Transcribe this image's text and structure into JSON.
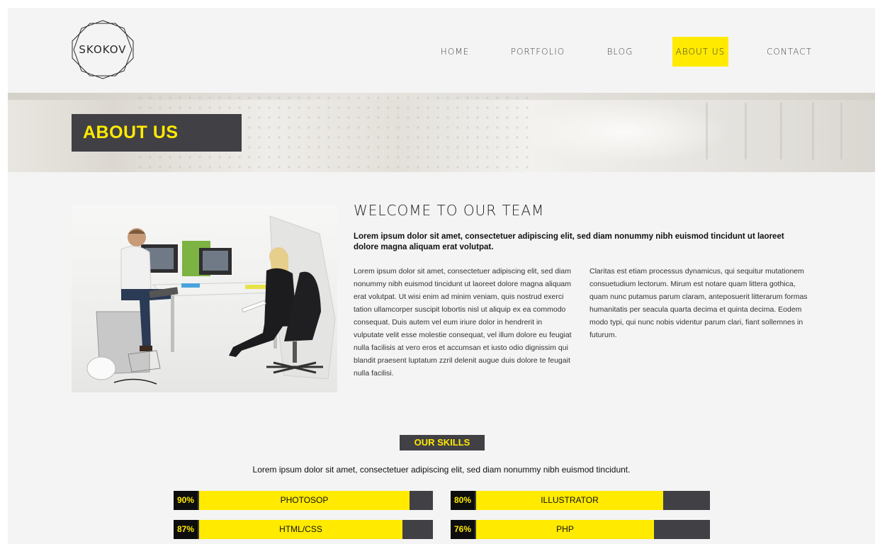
{
  "brand": {
    "logo_text": "SKOKOV",
    "accent": "#ffea00",
    "dark": "#414045"
  },
  "nav": {
    "items": [
      {
        "label": "HOME"
      },
      {
        "label": "PORTFOLIO"
      },
      {
        "label": "BLOG"
      },
      {
        "label": "ABOUT US"
      },
      {
        "label": "CONTACT"
      }
    ],
    "active": "ABOUT US"
  },
  "banner": {
    "title": "ABOUT US"
  },
  "welcome": {
    "title": "WELCOME TO OUR TEAM",
    "lead": "Lorem ipsum dolor sit amet, consectetuer adipiscing elit, sed diam nonummy nibh euismod tincidunt ut laoreet dolore magna aliquam erat volutpat.",
    "col1": "Lorem ipsum dolor sit amet, consectetuer adipiscing elit, sed diam nonummy nibh euismod tincidunt ut laoreet dolore magna aliquam erat volutpat. Ut wisi enim ad minim veniam, quis nostrud exerci tation ullamcorper suscipit lobortis nisl ut aliquip ex ea commodo consequat. Duis autem vel eum iriure dolor in hendrerit in vulputate velit esse molestie consequat, vel illum dolore eu feugiat nulla facilisis at vero eros et accumsan et iusto odio dignissim qui blandit praesent luptatum zzril delenit augue duis dolore te feugait nulla facilisi.",
    "col2": "Claritas est etiam processus dynamicus, qui sequitur mutationem consuetudium lectorum. Mirum est notare quam littera gothica, quam nunc putamus parum claram, anteposuerit litterarum formas humanitatis per seacula quarta decima et quinta decima. Eodem modo typi, qui nunc nobis videntur parum clari, fiant sollemnes in futurum."
  },
  "skills": {
    "label": "OUR SKILLS",
    "intro": "Lorem ipsum dolor sit amet, consectetuer adipiscing elit, sed diam nonummy nibh euismod tincidunt.",
    "items": [
      {
        "name": "PHOTOSOP",
        "percent_label": "90%",
        "percent": 90
      },
      {
        "name": "ILLUSTRATOR",
        "percent_label": "80%",
        "percent": 80
      },
      {
        "name": "HTML/CSS",
        "percent_label": "87%",
        "percent": 87
      },
      {
        "name": "PHP",
        "percent_label": "76%",
        "percent": 76
      }
    ]
  }
}
